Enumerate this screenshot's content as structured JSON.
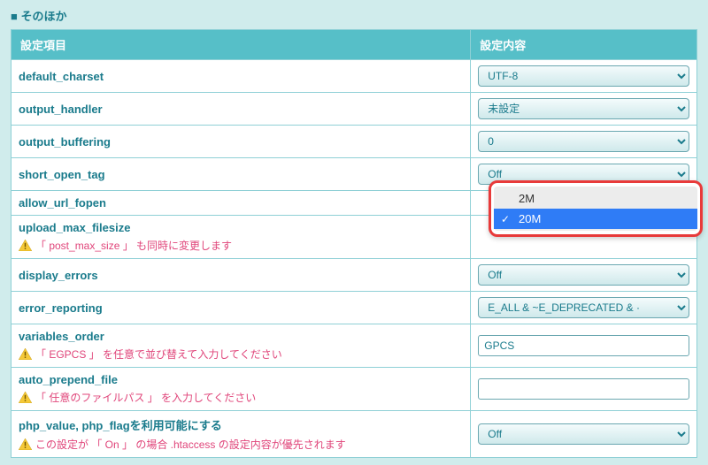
{
  "section": {
    "title": "■ そのほか"
  },
  "table": {
    "headers": {
      "item": "設定項目",
      "value": "設定内容"
    }
  },
  "rows": {
    "default_charset": {
      "label": "default_charset",
      "value": "UTF-8"
    },
    "output_handler": {
      "label": "output_handler",
      "value": "未設定"
    },
    "output_buffering": {
      "label": "output_buffering",
      "value": "0"
    },
    "short_open_tag": {
      "label": "short_open_tag",
      "value": "Off"
    },
    "allow_url_fopen": {
      "label": "allow_url_fopen",
      "value": ""
    },
    "upload_max_filesize": {
      "label": "upload_max_filesize",
      "note": "「 post_max_size 」 も同時に変更します",
      "value": "20M",
      "options": [
        "2M",
        "20M"
      ]
    },
    "display_errors": {
      "label": "display_errors",
      "value": "Off"
    },
    "error_reporting": {
      "label": "error_reporting",
      "value": "E_ALL & ~E_DEPRECATED & ·"
    },
    "variables_order": {
      "label": "variables_order",
      "note": "「 EGPCS 」 を任意で並び替えて入力してください",
      "value": "GPCS"
    },
    "auto_prepend_file": {
      "label": "auto_prepend_file",
      "note": "「 任意のファイルパス 」 を入力してください",
      "value": ""
    },
    "php_value_flag": {
      "label": "php_value, php_flagを利用可能にする",
      "note": "この設定が 「 On 」 の場合 .htaccess の設定内容が優先されます",
      "value": "Off"
    }
  }
}
